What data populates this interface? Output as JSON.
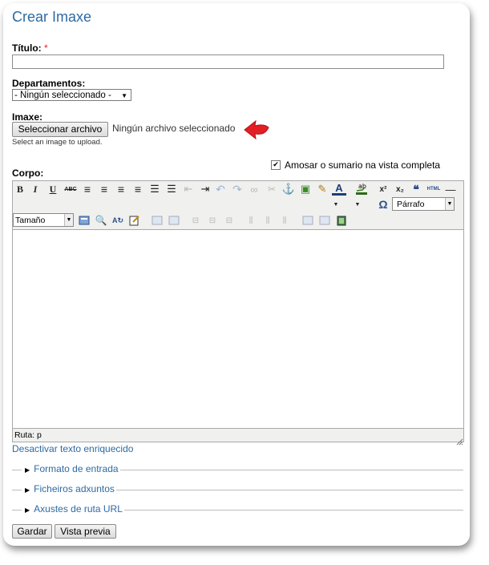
{
  "form": {
    "title": "Crear Imaxe",
    "titulo_label": "Título:",
    "required_mark": "*",
    "departamentos_label": "Departamentos:",
    "departamentos_value": "- Ningún seleccionado -",
    "imaxe_label": "Imaxe:",
    "file_button": "Seleccionar archivo",
    "file_status": "Ningún archivo seleccionado",
    "file_help": "Select an image to upload.",
    "summary_checkbox": "Amosar o sumario na vista completa",
    "summary_checked": true,
    "corpo_label": "Corpo:",
    "disable_rich": "Desactivar texto enriquecido",
    "fieldsets": [
      "Formato de entrada",
      "Ficheiros adxuntos",
      "Axustes de ruta URL"
    ],
    "save_button": "Gardar",
    "preview_button": "Vista previa"
  },
  "editor": {
    "format_select": "Párrafo",
    "size_select": "Tamaño",
    "path_label": "Ruta: p",
    "toolbar_row1": [
      {
        "name": "bold",
        "glyph": "B"
      },
      {
        "name": "italic",
        "glyph": "I"
      },
      {
        "name": "underline",
        "glyph": "U"
      },
      {
        "name": "strikethrough",
        "glyph": "ABC"
      },
      {
        "name": "align-left",
        "glyph": "≡"
      },
      {
        "name": "align-center",
        "glyph": "≡"
      },
      {
        "name": "align-right",
        "glyph": "≡"
      },
      {
        "name": "justify",
        "glyph": "≡"
      },
      {
        "name": "bullet-list",
        "glyph": "☰"
      },
      {
        "name": "numbered-list",
        "glyph": "☰"
      },
      {
        "name": "outdent",
        "glyph": "⇤"
      },
      {
        "name": "indent",
        "glyph": "⇥"
      },
      {
        "name": "undo",
        "glyph": "↶"
      },
      {
        "name": "redo",
        "glyph": "↷"
      },
      {
        "name": "link",
        "glyph": "∞"
      },
      {
        "name": "unlink",
        "glyph": "✂"
      },
      {
        "name": "anchor",
        "glyph": "⚓"
      },
      {
        "name": "image",
        "glyph": "▣"
      },
      {
        "name": "cleanup",
        "glyph": "✎"
      },
      {
        "name": "font-color",
        "glyph": "A"
      },
      {
        "name": "highlight",
        "glyph": "ab"
      },
      {
        "name": "superscript",
        "glyph": "x²"
      },
      {
        "name": "subscript",
        "glyph": "x₂"
      },
      {
        "name": "blockquote",
        "glyph": "❝"
      },
      {
        "name": "html",
        "glyph": "HTML"
      },
      {
        "name": "horizontal-rule",
        "glyph": "—"
      }
    ],
    "special_char": "Ω"
  },
  "colors": {
    "accent": "#2d6aa3",
    "required": "#e0212b",
    "arrow": "#e31e24"
  }
}
